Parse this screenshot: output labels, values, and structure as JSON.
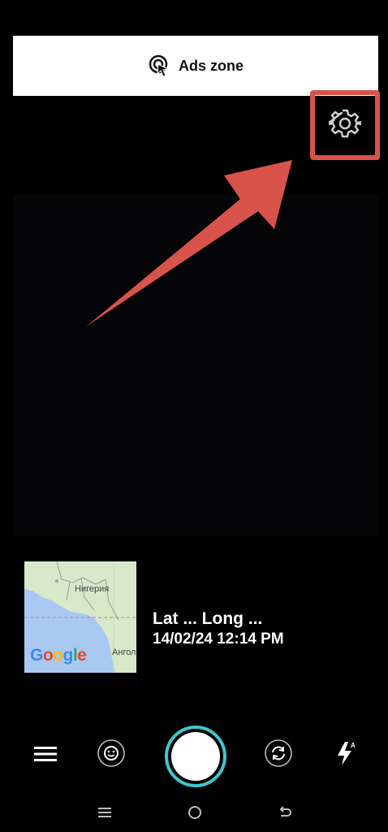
{
  "ad": {
    "label": "Ads zone",
    "icon": "tap-cursor-icon"
  },
  "settings": {
    "icon": "gear-icon"
  },
  "map": {
    "labels": {
      "nigeria": "Нигерия",
      "angola": "Ангол"
    },
    "brand": "Google",
    "colors": {
      "water": "#a9c9f2",
      "land": "#d8e8c8",
      "accent": "#d9534a"
    }
  },
  "info": {
    "coords": "Lat ... Long ...",
    "datetime": "14/02/24 12:14 PM"
  },
  "controls": {
    "menu": "menu-icon",
    "filter": "face-filter-icon",
    "shutter": "shutter-button",
    "switch": "switch-camera-icon",
    "flash": "flash-auto-icon"
  },
  "theme": {
    "accent": "#3fc6cf",
    "highlight": "#d9534a"
  }
}
